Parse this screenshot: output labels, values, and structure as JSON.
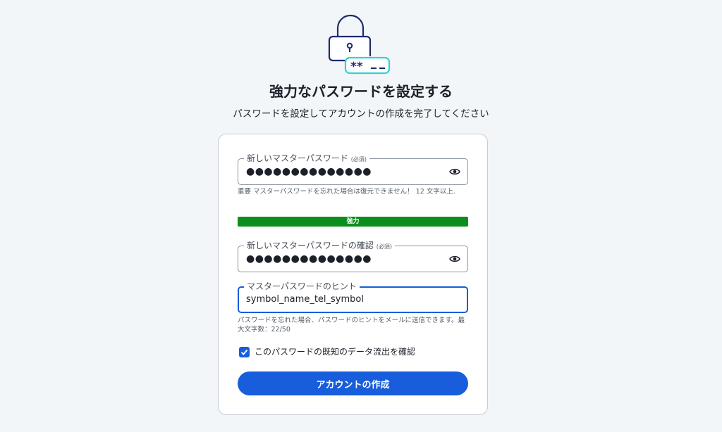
{
  "header": {
    "title": "強力なパスワードを設定する",
    "subtitle": "パスワードを設定してアカウントの作成を完了してください"
  },
  "form": {
    "new_password": {
      "label": "新しいマスターパスワード",
      "required": "(必須)",
      "value_masked": "●●●●●●●●●●●●●●",
      "hint": "重要 マスターパスワードを忘れた場合は復元できません！ 12 文字以上."
    },
    "strength": {
      "label": "強力",
      "level_fraction": 1.0,
      "color": "#0b8f1c"
    },
    "confirm_password": {
      "label": "新しいマスターパスワードの確認",
      "required": "(必須)",
      "value_masked": "●●●●●●●●●●●●●●"
    },
    "password_hint": {
      "label": "マスターパスワードのヒント",
      "value": "symbol_name_tel_symbol",
      "help": "パスワードを忘れた場合、パスワードのヒントをメールに送信できます。最大文字数：22/50"
    },
    "breach_check": {
      "label": "このパスワードの既知のデータ流出を確認",
      "checked": true
    },
    "submit_label": "アカウントの作成"
  },
  "icons": {
    "lock": "lock-icon",
    "eye": "eye-icon",
    "check": "check-icon"
  },
  "colors": {
    "accent": "#175ddc",
    "success": "#0b8f1c",
    "background": "#f3f6f9",
    "illustration_navy": "#1f2a6b",
    "illustration_teal": "#2bd4d4"
  }
}
